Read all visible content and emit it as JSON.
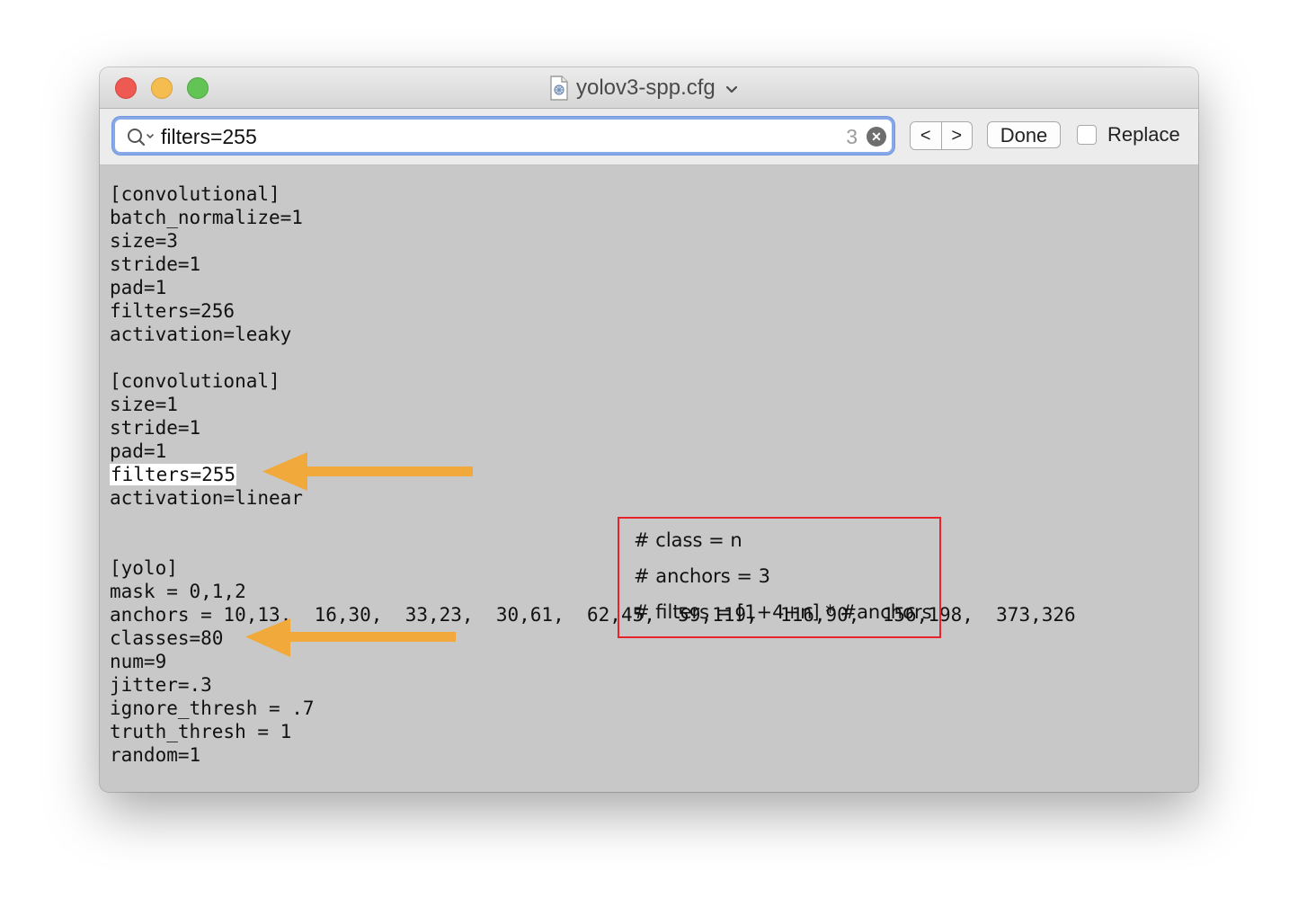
{
  "window": {
    "title": "yolov3-spp.cfg"
  },
  "find_bar": {
    "search_value": "filters=255",
    "match_count": "3",
    "done_label": "Done",
    "replace_label": "Replace",
    "prev_label": "<",
    "next_label": ">"
  },
  "editor": {
    "lines": [
      "[convolutional]",
      "batch_normalize=1",
      "size=3",
      "stride=1",
      "pad=1",
      "filters=256",
      "activation=leaky",
      "",
      "[convolutional]",
      "size=1",
      "stride=1",
      "pad=1",
      "filters=255",
      "activation=linear",
      "",
      "",
      "[yolo]",
      "mask = 0,1,2",
      "anchors = 10,13,  16,30,  33,23,  30,61,  62,45,  59,119,  116,90,  156,198,  373,326",
      "classes=80",
      "num=9",
      "jitter=.3",
      "ignore_thresh = .7",
      "truth_thresh = 1",
      "random=1"
    ],
    "highlighted_line_index": 12
  },
  "annotation": {
    "lines": [
      "# class = n",
      "# anchors = 3",
      "# filters = [1+4+n] * #anchors"
    ],
    "border_color": "#e8232c"
  },
  "arrows": {
    "color": "#f2a93b",
    "targets": [
      "filters=255",
      "classes=80"
    ]
  },
  "colors": {
    "editor_background": "#c8c8c8",
    "search_focus_ring": "#88a9e8",
    "close_light": "#ee5a52",
    "minimize_light": "#f5bd4f",
    "maximize_light": "#61c454"
  },
  "icons": {
    "file": "cfg-file-icon",
    "search": "search-icon",
    "clear": "clear-icon",
    "dropdown": "chevron-down-icon"
  }
}
